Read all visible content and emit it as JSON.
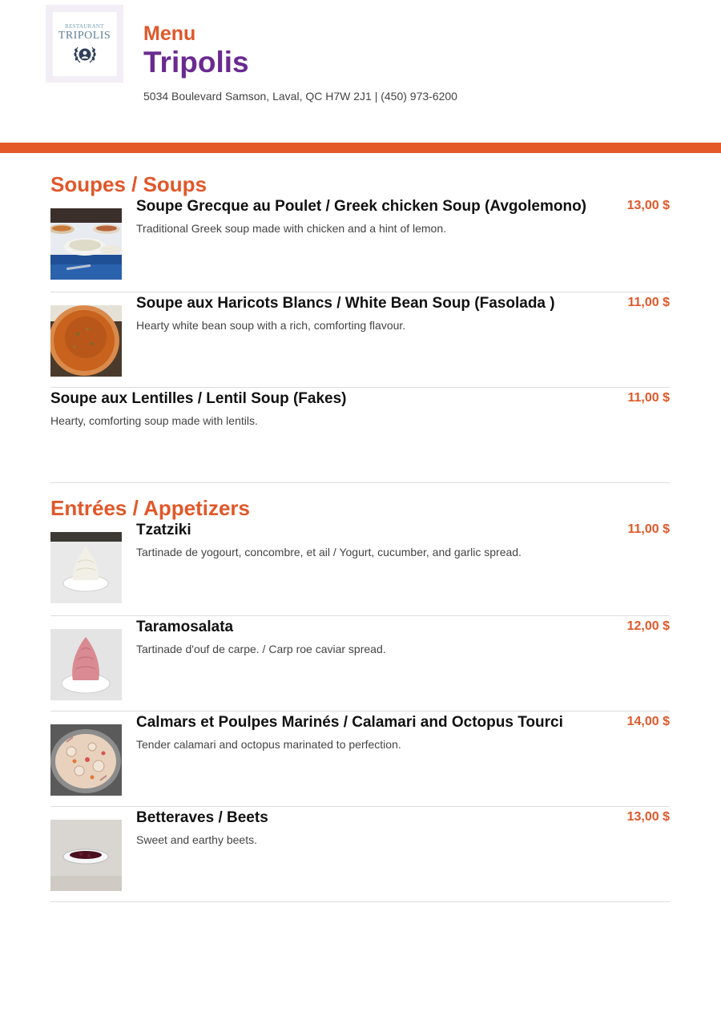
{
  "header": {
    "logo": {
      "small": "RESTAURANT",
      "big": "TRIPOLIS"
    },
    "menu_word": "Menu",
    "restaurant_name": "Tripolis",
    "address": "5034 Boulevard Samson, Laval, QC H7W 2J1 | (450) 973-6200"
  },
  "colors": {
    "accent": "#e45a29",
    "brand": "#6a2a90"
  },
  "sections": [
    {
      "title": "Soupes / Soups",
      "items": [
        {
          "name": "Soupe Grecque au Poulet / Greek chicken Soup (Avgolemono)",
          "description": "Traditional Greek soup made with chicken and a hint of lemon.",
          "price": "13,00 $",
          "photo": "bowls-of-soup-photo"
        },
        {
          "name": "Soupe aux Haricots Blancs / White Bean Soup (Fasolada )",
          "description": "Hearty white bean soup with a rich, comforting flavour.",
          "price": "11,00 $",
          "photo": "orange-soup-photo"
        },
        {
          "name": "Soupe aux Lentilles / Lentil Soup (Fakes)",
          "description": "Hearty, comforting soup made with lentils.",
          "price": "11,00 $"
        }
      ]
    },
    {
      "title": "Entrées / Appetizers",
      "items": [
        {
          "name": "Tzatziki",
          "description": "Tartinade de yogourt, concombre, et ail / Yogurt, cucumber, and garlic spread.",
          "price": "11,00 $",
          "photo": "tzatziki-photo"
        },
        {
          "name": "Taramosalata",
          "description": "Tartinade d'ouf de carpe. / Carp roe caviar spread.",
          "price": "12,00 $",
          "photo": "taramosalata-photo"
        },
        {
          "name": "Calmars et Poulpes Marinés / Calamari and Octopus Tourci",
          "description": "Tender calamari and octopus marinated to perfection.",
          "price": "14,00 $",
          "photo": "calamari-photo"
        },
        {
          "name": "Betteraves / Beets",
          "description": "Sweet and earthy beets.",
          "price": "13,00 $",
          "photo": "beets-photo"
        }
      ]
    }
  ]
}
